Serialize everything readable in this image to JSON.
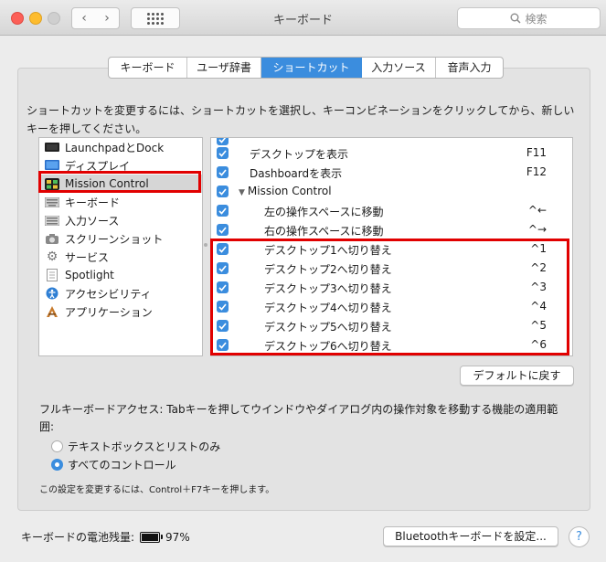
{
  "window": {
    "title": "キーボード",
    "search_placeholder": "検索"
  },
  "tabs": [
    {
      "label": "キーボード"
    },
    {
      "label": "ユーザ辞書"
    },
    {
      "label": "ショートカット"
    },
    {
      "label": "入力ソース"
    },
    {
      "label": "音声入力"
    }
  ],
  "selected_tab": "ショートカット",
  "description": "ショートカットを変更するには、ショートカットを選択し、キーコンビネーションをクリックしてから、新しいキーを押してください。",
  "categories": [
    {
      "label": "LaunchpadとDock",
      "icon": "launchpad-icon"
    },
    {
      "label": "ディスプレイ",
      "icon": "display-icon"
    },
    {
      "label": "Mission Control",
      "icon": "mission-control-icon"
    },
    {
      "label": "キーボード",
      "icon": "keyboard-icon"
    },
    {
      "label": "入力ソース",
      "icon": "input-source-icon"
    },
    {
      "label": "スクリーンショット",
      "icon": "screenshot-icon"
    },
    {
      "label": "サービス",
      "icon": "gear-icon"
    },
    {
      "label": "Spotlight",
      "icon": "spotlight-icon"
    },
    {
      "label": "アクセシビリティ",
      "icon": "accessibility-icon"
    },
    {
      "label": "アプリケーション",
      "icon": "app-shortcut-icon"
    }
  ],
  "selected_category": "Mission Control",
  "shortcuts": [
    {
      "label": "デスクトップを表示",
      "key": "F11",
      "checked": true
    },
    {
      "label": "Dashboardを表示",
      "key": "F12",
      "checked": true
    },
    {
      "label": "Mission Control",
      "key": "",
      "checked": true
    },
    {
      "label": "左の操作スペースに移動",
      "key": "^←",
      "checked": true
    },
    {
      "label": "右の操作スペースに移動",
      "key": "^→",
      "checked": true
    },
    {
      "label": "デスクトップ1へ切り替え",
      "key": "^1",
      "checked": true
    },
    {
      "label": "デスクトップ2へ切り替え",
      "key": "^2",
      "checked": true
    },
    {
      "label": "デスクトップ3へ切り替え",
      "key": "^3",
      "checked": true
    },
    {
      "label": "デスクトップ4へ切り替え",
      "key": "^4",
      "checked": true
    },
    {
      "label": "デスクトップ5へ切り替え",
      "key": "^5",
      "checked": true
    },
    {
      "label": "デスクトップ6へ切り替え",
      "key": "^6",
      "checked": true
    }
  ],
  "restore_defaults_label": "デフォルトに戻す",
  "full_keyboard_access": {
    "text": "フルキーボードアクセス: Tabキーを押してウインドウやダイアログ内の操作対象を移動する機能の適用範囲:",
    "options": [
      {
        "label": "テキストボックスとリストのみ",
        "selected": false
      },
      {
        "label": "すべてのコントロール",
        "selected": true
      }
    ],
    "hint": "この設定を変更するには、Control＋F7キーを押します。"
  },
  "battery": {
    "label": "キーボードの電池残量:",
    "value": "97%"
  },
  "bluetooth_button_label": "Bluetoothキーボードを設定...",
  "help_label": "?",
  "colors": {
    "accent": "#3b8dde",
    "annotation": "#e10000"
  }
}
